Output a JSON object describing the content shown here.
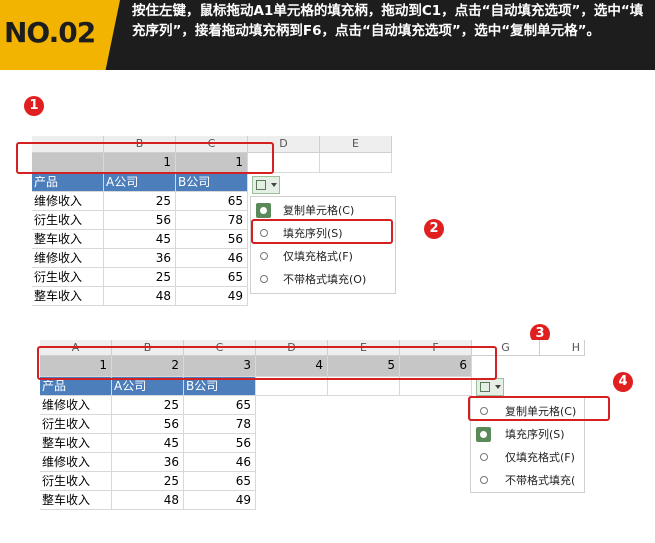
{
  "header": {
    "badge": "NO.02",
    "instruction": "按住左键，鼠标拖动A1单元格的填充柄，拖动到C1，点击“自动填充选项”，选中“填充序列”，接着拖动填充柄到F6，点击“自动填充选项”，选中“复制单元格”。"
  },
  "steps": [
    "1",
    "2",
    "3",
    "4"
  ],
  "sheet1": {
    "col_headers": [
      "B",
      "C",
      "D",
      "E"
    ],
    "row1": [
      "1",
      "1"
    ],
    "table_header": [
      "产品",
      "A公司",
      "B公司"
    ],
    "rows": [
      [
        "维修收入",
        "25",
        "65"
      ],
      [
        "衍生收入",
        "56",
        "78"
      ],
      [
        "整车收入",
        "45",
        "56"
      ],
      [
        "维修收入",
        "36",
        "46"
      ],
      [
        "衍生收入",
        "25",
        "65"
      ],
      [
        "整车收入",
        "48",
        "49"
      ]
    ],
    "menu": [
      "复制单元格(C)",
      "填充序列(S)",
      "仅填充格式(F)",
      "不带格式填充(O)"
    ],
    "selected_option": "复制单元格(C)"
  },
  "sheet2": {
    "col_headers": [
      "A",
      "B",
      "C",
      "D",
      "E",
      "F",
      "G",
      "H"
    ],
    "row1": [
      "1",
      "2",
      "3",
      "4",
      "5",
      "6"
    ],
    "table_header": [
      "产品",
      "A公司",
      "B公司"
    ],
    "rows": [
      [
        "维修收入",
        "25",
        "65"
      ],
      [
        "衍生收入",
        "56",
        "78"
      ],
      [
        "整车收入",
        "45",
        "56"
      ],
      [
        "维修收入",
        "36",
        "46"
      ],
      [
        "衍生收入",
        "25",
        "65"
      ],
      [
        "整车收入",
        "48",
        "49"
      ]
    ],
    "menu": [
      "复制单元格(C)",
      "填充序列(S)",
      "仅填充格式(F)",
      "不带格式填充("
    ],
    "selected_option": "填充序列(S)"
  },
  "colors": {
    "accent": "#f2b400",
    "highlight": "#d42020",
    "table_header": "#4c7ebb",
    "selection": "#c6c6c6"
  }
}
